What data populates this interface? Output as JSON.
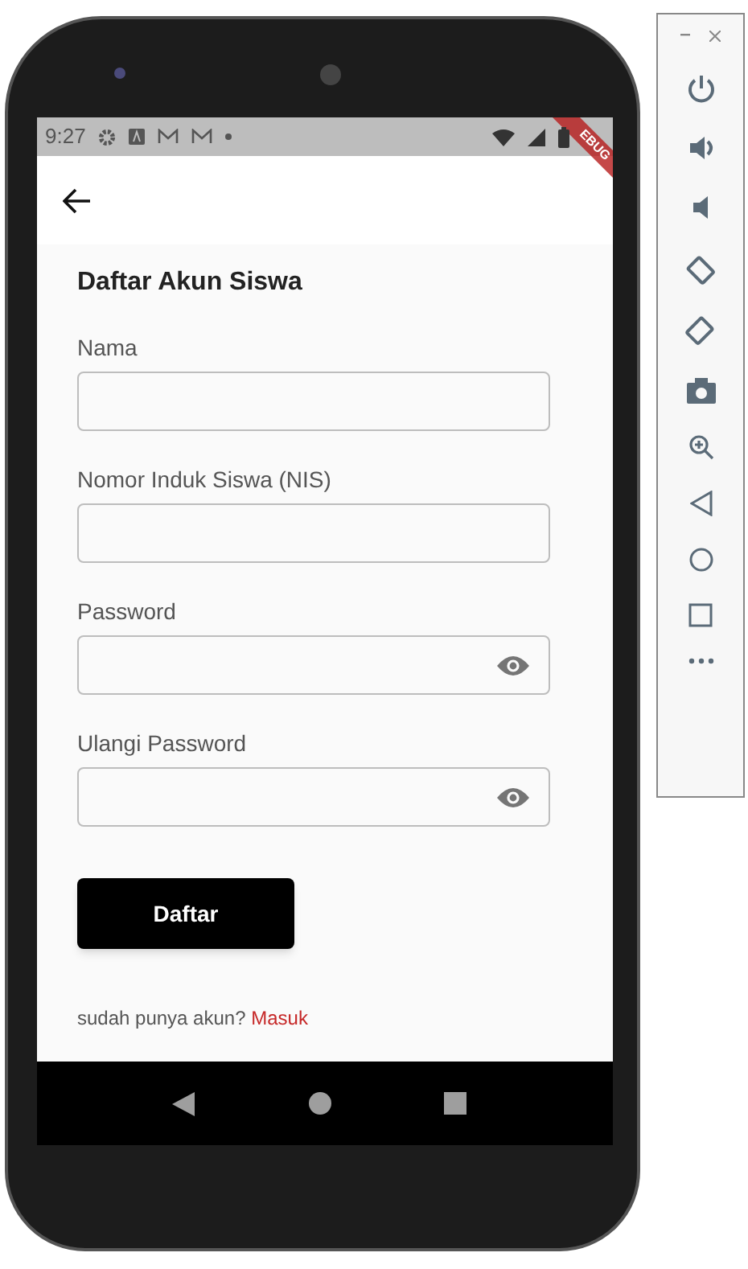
{
  "status_bar": {
    "time": "9:27"
  },
  "debug_banner": {
    "text": "EBUG"
  },
  "title": "Daftar Akun Siswa",
  "fields": [
    {
      "label": "Nama",
      "kind": "text"
    },
    {
      "label": "Nomor Induk Siswa (NIS)",
      "kind": "text"
    },
    {
      "label": "Password",
      "kind": "password"
    },
    {
      "label": "Ulangi Password",
      "kind": "password"
    }
  ],
  "submit_button": "Daftar",
  "footer": {
    "text": "sudah punya akun?",
    "link": "Masuk"
  }
}
